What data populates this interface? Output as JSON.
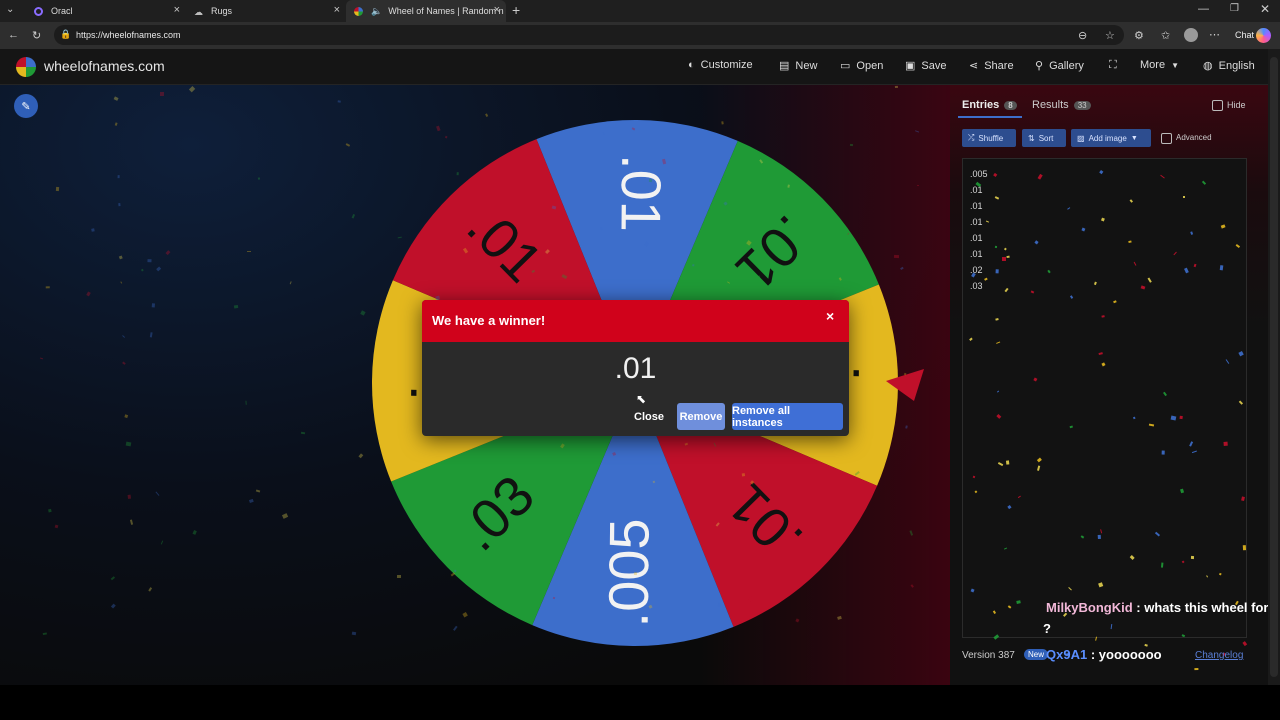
{
  "browser": {
    "tabs": [
      {
        "title": "Oracl"
      },
      {
        "title": "Rugs"
      },
      {
        "title": "Wheel of Names | Random n"
      }
    ],
    "url": "https://wheelofnames.com",
    "chat_label": "Chat"
  },
  "site": {
    "logo": "wheelofnames.com",
    "menu": [
      {
        "label": "Customize",
        "icon": "palette-icon"
      },
      {
        "label": "New",
        "icon": "file-icon"
      },
      {
        "label": "Open",
        "icon": "folder-icon"
      },
      {
        "label": "Save",
        "icon": "save-icon"
      },
      {
        "label": "Share",
        "icon": "share-icon"
      },
      {
        "label": "Gallery",
        "icon": "search-icon"
      },
      {
        "label": "",
        "icon": "fullscreen-icon"
      },
      {
        "label": "More",
        "icon": "chevron-down-icon"
      },
      {
        "label": "English",
        "icon": "globe-icon"
      }
    ]
  },
  "wheel": {
    "slices": [
      ".01",
      ".01",
      ".01",
      ".01",
      ".005",
      ".03",
      ".02",
      ".01"
    ],
    "colors": {
      "blue": "#3d6ecb",
      "green": "#1f9a36",
      "yellow": "#e3b81f",
      "red": "#c0102a"
    }
  },
  "panel": {
    "tab_entries": "Entries",
    "entries_count": "8",
    "tab_results": "Results",
    "results_count": "33",
    "hide_label": "Hide",
    "shuffle": "Shuffle",
    "sort": "Sort",
    "add_image": "Add image",
    "advanced": "Advanced",
    "entries": [
      ".005",
      ".01",
      ".01",
      ".01",
      ".01",
      ".01",
      ".02",
      ".03"
    ],
    "version": "Version 387",
    "new_badge": "New",
    "changelog": "Changelog"
  },
  "modal": {
    "title": "We have a winner!",
    "winner": ".01",
    "close": "Close",
    "remove": "Remove",
    "remove_all": "Remove all instances"
  },
  "chat": [
    {
      "user": "MilkyBongKid",
      "text": ": whats this wheel for",
      "cont": "?"
    },
    {
      "user": "Qx9A1",
      "text": ": yooooooo"
    }
  ]
}
